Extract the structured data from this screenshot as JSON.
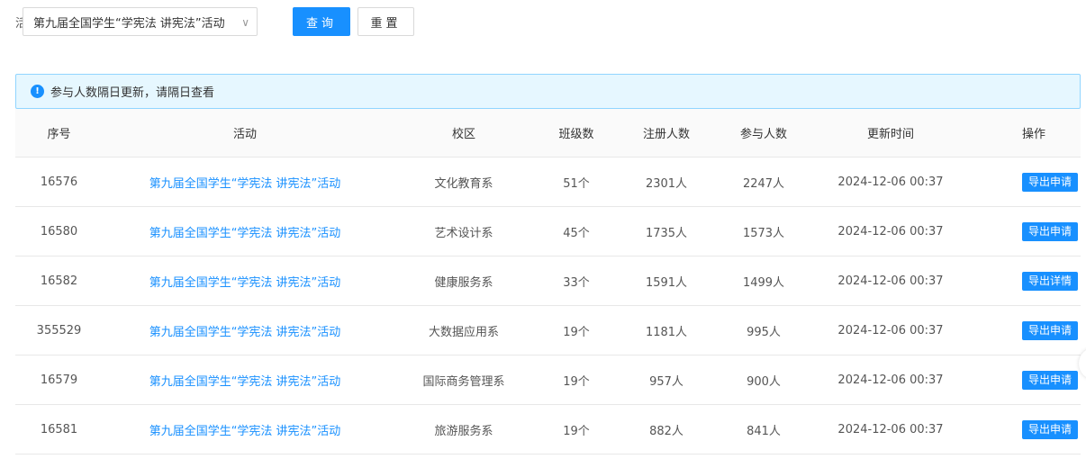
{
  "filter": {
    "label": "活动",
    "selected": "第九届全国学生“学宪法 讲宪法”活动",
    "chevron": "chevron-down-icon",
    "query_label": "查询",
    "reset_label": "重置"
  },
  "alert": {
    "icon": "info-icon",
    "icon_glyph": "!",
    "text": "参与人数隔日更新，请隔日查看"
  },
  "table": {
    "columns": [
      "序号",
      "活动",
      "校区",
      "班级数",
      "注册人数",
      "参与人数",
      "更新时间",
      "操作"
    ],
    "rows": [
      {
        "id": "16576",
        "activity": "第九届全国学生“学宪法 讲宪法”活动",
        "campus": "文化教育系",
        "classes": "51个",
        "registered": "2301人",
        "participants": "2247人",
        "updated": "2024-12-06 00:37",
        "action": "导出申请"
      },
      {
        "id": "16580",
        "activity": "第九届全国学生“学宪法 讲宪法”活动",
        "campus": "艺术设计系",
        "classes": "45个",
        "registered": "1735人",
        "participants": "1573人",
        "updated": "2024-12-06 00:37",
        "action": "导出申请"
      },
      {
        "id": "16582",
        "activity": "第九届全国学生“学宪法 讲宪法”活动",
        "campus": "健康服务系",
        "classes": "33个",
        "registered": "1591人",
        "participants": "1499人",
        "updated": "2024-12-06 00:37",
        "action": "导出详情"
      },
      {
        "id": "355529",
        "activity": "第九届全国学生“学宪法 讲宪法”活动",
        "campus": "大数据应用系",
        "classes": "19个",
        "registered": "1181人",
        "participants": "995人",
        "updated": "2024-12-06 00:37",
        "action": "导出申请"
      },
      {
        "id": "16579",
        "activity": "第九届全国学生“学宪法 讲宪法”活动",
        "campus": "国际商务管理系",
        "classes": "19个",
        "registered": "957人",
        "participants": "900人",
        "updated": "2024-12-06 00:37",
        "action": "导出申请"
      },
      {
        "id": "16581",
        "activity": "第九届全国学生“学宪法 讲宪法”活动",
        "campus": "旅游服务系",
        "classes": "19个",
        "registered": "882人",
        "participants": "841人",
        "updated": "2024-12-06 00:37",
        "action": "导出申请"
      }
    ]
  },
  "colors": {
    "primary": "#1890ff",
    "alert_bg": "#e6f7ff",
    "alert_border": "#91d5ff",
    "header_bg": "#fafafa"
  }
}
